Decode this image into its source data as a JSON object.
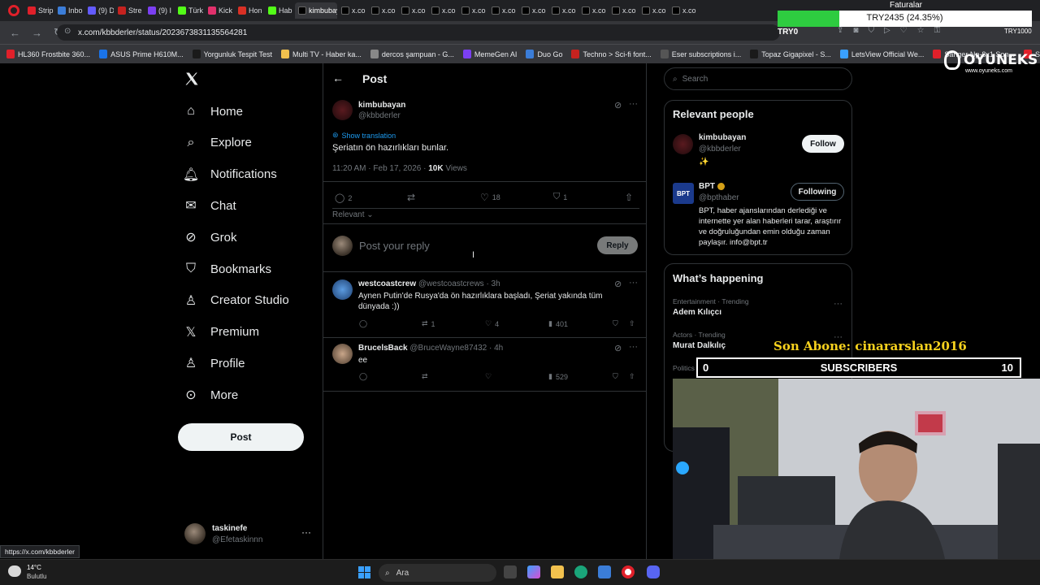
{
  "browser": {
    "tabs": [
      "Strip",
      "Inbo",
      "(9) D",
      "Stre",
      "(9) I",
      "Türk",
      "Kick",
      "Hon",
      "Hab",
      "kimbubaya",
      "x.co",
      "x.co",
      "x.co",
      "x.co",
      "x.co",
      "x.co",
      "x.co",
      "x.co",
      "x.co",
      "x.co",
      "x.co",
      "x.co"
    ],
    "url": "x.com/kbbderler/status/2023673831135564281",
    "bookmarks": [
      "HL360 Frostbite 360...",
      "ASUS Prime H610M...",
      "Yorgunluk Tespit Test",
      "Multi TV - Haber ka...",
      "dercos şampuan - G...",
      "MemeGen AI",
      "Duo Go",
      "Techno > Sci-fi font...",
      "Eser subscriptions i...",
      "Topaz Gigapixel - S...",
      "LetsView Official We...",
      "Sanger Np-8x1 Son...",
      "Sanger Np-8X1 Son..."
    ],
    "status_url": "https://x.com/kbbderler"
  },
  "overlay": {
    "faturalar": "Faturalar",
    "goal_text": "TRY2435 (24.35%)",
    "goal_progress": 0.2435,
    "try_label": "TRY0",
    "try_right": "TRY1000",
    "brand": "OYUNEKS",
    "brand_url": "www.oyuneks.com",
    "son_abone": "Son Abone: cinararslan2016",
    "sub_left": "0",
    "sub_label": "SUBSCRIBERS",
    "sub_right": "10"
  },
  "nav": {
    "items": [
      {
        "label": "Home",
        "icon": "home-icon"
      },
      {
        "label": "Explore",
        "icon": "search-icon"
      },
      {
        "label": "Notifications",
        "icon": "bell-icon"
      },
      {
        "label": "Chat",
        "icon": "mail-icon"
      },
      {
        "label": "Grok",
        "icon": "grok-icon"
      },
      {
        "label": "Bookmarks",
        "icon": "bookmark-icon"
      },
      {
        "label": "Creator Studio",
        "icon": "creator-icon"
      },
      {
        "label": "Premium",
        "icon": "x-logo-icon"
      },
      {
        "label": "Profile",
        "icon": "person-icon"
      },
      {
        "label": "More",
        "icon": "more-circle-icon"
      }
    ],
    "post_button": "Post",
    "account_name": "taskinefe",
    "account_handle": "@Efetaskinnn"
  },
  "post": {
    "header": "Post",
    "author": "kimbubayan",
    "handle": "@kbbderler",
    "show_translation": "Show translation",
    "text": "Şeriatın ön hazırlıkları bunlar.",
    "time": "11:20 AM · Feb 17, 2026 · ",
    "views_count": "10K",
    "views_label": " Views",
    "replies": "2",
    "likes": "18",
    "bookmarks": "1",
    "sort": "Relevant",
    "reply_placeholder": "Post your reply",
    "reply_button": "Reply"
  },
  "replies": [
    {
      "name": "westcoastcrew",
      "handle": "@westcoastcrews · 3h",
      "text": "Aynen Putin'de Rusya'da ön hazırlıklara başladı, Şeriat yakında tüm dünyada :))",
      "reposts": "1",
      "likes": "4",
      "views": "401"
    },
    {
      "name": "BrucelsBack",
      "handle": "@BruceWayne87432 · 4h",
      "text": "ee",
      "reposts": "",
      "likes": "",
      "views": "529"
    }
  ],
  "right": {
    "search_placeholder": "Search",
    "relevant_title": "Relevant people",
    "people": [
      {
        "name": "kimbubayan",
        "handle": "@kbbderler",
        "bio": "✨",
        "button": "Follow"
      },
      {
        "name": "BPT",
        "handle": "@bpthaber",
        "bio": "BPT, haber ajanslarından derlediği ve internette yer alan haberleri tarar, araştırır ve doğruluğundan emin olduğu zaman paylaşır. info@bpt.tr",
        "button": "Following"
      }
    ],
    "happening_title": "What’s happening",
    "trends": [
      {
        "context": "Entertainment · Trending",
        "name": "Adem Kılıçcı"
      },
      {
        "context": "Actors · Trending",
        "name": "Murat Dalkılıç"
      },
      {
        "context": "Politics · Trending",
        "name": ""
      }
    ]
  },
  "taskbar": {
    "temp": "14°C",
    "weather": "Bulutlu",
    "search": "Ara"
  }
}
